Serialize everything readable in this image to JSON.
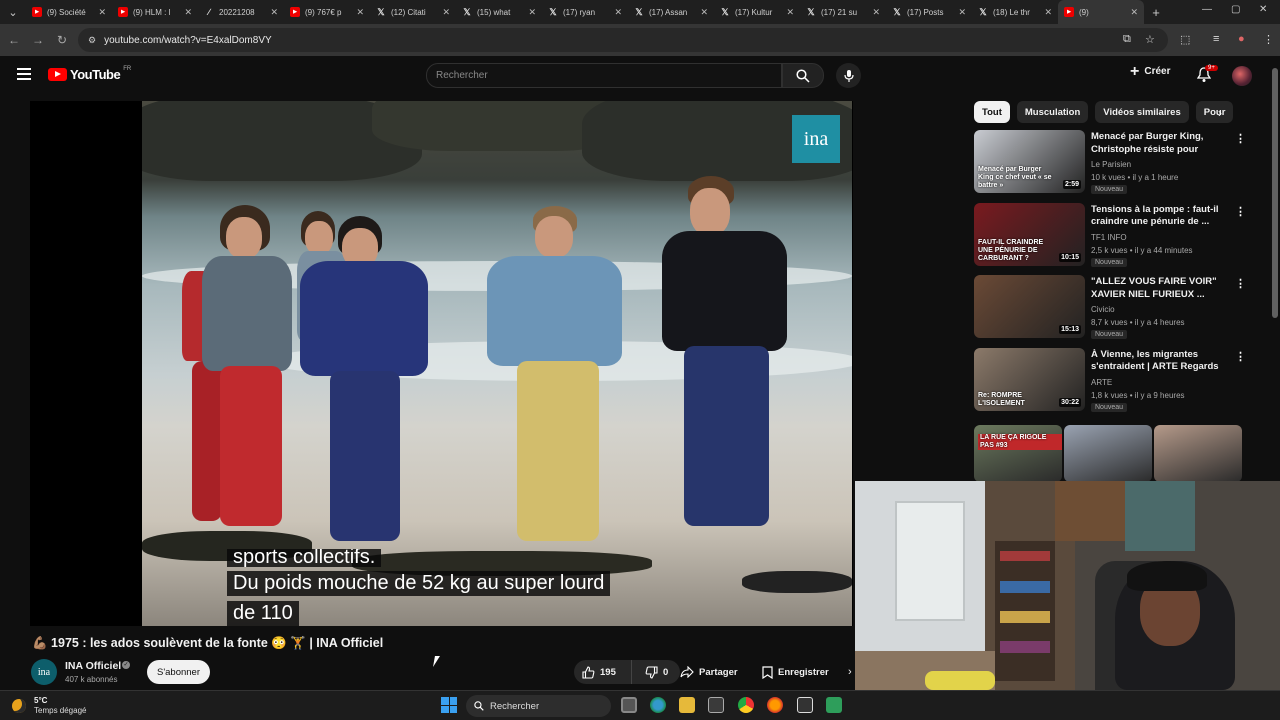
{
  "browser": {
    "tabs": [
      {
        "icon": "youtube",
        "title": "(9) Société"
      },
      {
        "icon": "youtube",
        "title": "(9) HLM : l"
      },
      {
        "icon": "slash",
        "title": "20221208"
      },
      {
        "icon": "youtube",
        "title": "(9) 767€ p"
      },
      {
        "icon": "x",
        "title": "(12) Citati"
      },
      {
        "icon": "x",
        "title": "(15) what"
      },
      {
        "icon": "x",
        "title": "(17) ryan"
      },
      {
        "icon": "x",
        "title": "(17) Assan"
      },
      {
        "icon": "x",
        "title": "(17) Kultur"
      },
      {
        "icon": "x",
        "title": "(17) 21 su"
      },
      {
        "icon": "x",
        "title": "(17) Posts"
      },
      {
        "icon": "x",
        "title": "(18) Le thr"
      },
      {
        "icon": "youtube",
        "title": "(9)"
      }
    ],
    "url": "youtube.com/watch?v=E4xalDom8VY"
  },
  "header": {
    "logo_text": "YouTube",
    "country": "FR",
    "search_placeholder": "Rechercher",
    "create_label": "Créer",
    "notif_count": "9+"
  },
  "video": {
    "channel_badge": "ina",
    "subtitle_line1": "sports collectifs.",
    "subtitle_line2": "Du poids mouche de 52 kg au super lourd",
    "subtitle_line3": "de 110",
    "title": "💪🏽 1975 : les ados soulèvent de la fonte 😳 🏋 | INA Officiel",
    "channel_name": "INA Officiel",
    "channel_avatar": "ina",
    "subscribers": "407 k abonnés",
    "subscribe_label": "S'abonner",
    "likes": "195",
    "dislikes": "0",
    "share_label": "Partager",
    "save_label": "Enregistrer"
  },
  "sidebar": {
    "chips": [
      "Tout",
      "Musculation",
      "Vidéos similaires",
      "Pour"
    ],
    "recommendations": [
      {
        "title": "Menacé par Burger King, Christophe résiste pour sauver...",
        "channel": "Le Parisien",
        "meta": "10 k vues • il y a 1 heure",
        "badge": "Nouveau",
        "duration": "2:59",
        "caption": "Menacé par Burger King ce chef veut « se battre »",
        "color": "#c9ccd2"
      },
      {
        "title": "Tensions à la pompe : faut-il craindre une pénurie de ...",
        "channel": "TF1 INFO",
        "meta": "2,5 k vues • il y a 44 minutes",
        "badge": "Nouveau",
        "duration": "10:15",
        "caption": "FAUT-IL CRAINDRE UNE PÉNURIE DE CARBURANT ?",
        "color": "#7a1a1f"
      },
      {
        "title": "\"ALLEZ VOUS FAIRE VOIR\" XAVIER NIEL FURIEUX ...",
        "channel": "Civicio",
        "meta": "8,7 k vues • il y a 4 heures",
        "badge": "Nouveau",
        "duration": "15:13",
        "caption": "",
        "color": "#6b4a36"
      },
      {
        "title": "À Vienne, les migrantes s'entraident | ARTE Regards",
        "channel": "ARTE",
        "meta": "1,8 k vues • il y a 9 heures",
        "badge": "Nouveau",
        "duration": "30:22",
        "caption": "Re: ROMPRE L'ISOLEMENT",
        "color": "#8c7a6a"
      }
    ],
    "shorts": [
      {
        "caption": "LA RUE ÇA RIGOLE PAS #93",
        "color": "#6c7a5e"
      },
      {
        "caption": "",
        "color": "#9aa3b2"
      },
      {
        "caption": "",
        "color": "#b59a8a"
      }
    ]
  },
  "taskbar": {
    "temperature": "5°C",
    "weather": "Temps dégagé",
    "search_label": "Rechercher"
  }
}
